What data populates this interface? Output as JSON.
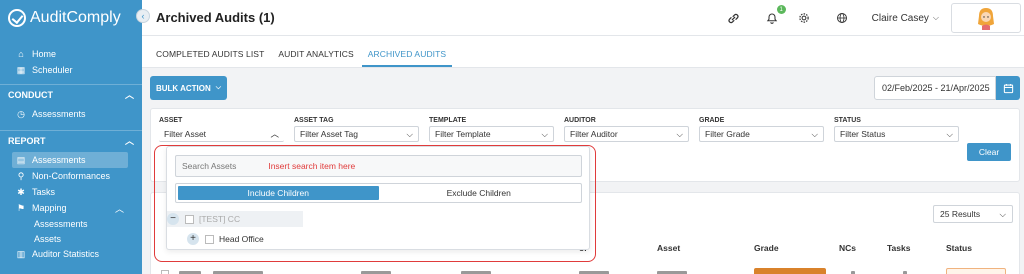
{
  "app": {
    "brand": "AuditComply",
    "page_title": "Archived Audits (1)"
  },
  "sidebar": {
    "top_items": [
      {
        "label": "Home",
        "icon": "home-icon"
      },
      {
        "label": "Scheduler",
        "icon": "calendar-icon"
      }
    ],
    "sections": [
      {
        "title": "CONDUCT",
        "items": [
          {
            "label": "Assessments",
            "icon": "clock-icon"
          }
        ]
      },
      {
        "title": "REPORT",
        "items": [
          {
            "label": "Assessments",
            "icon": "list-icon",
            "active": true
          },
          {
            "label": "Non-Conformances",
            "icon": "search-icon"
          },
          {
            "label": "Tasks",
            "icon": "tasks-icon"
          },
          {
            "label": "Mapping",
            "icon": "pin-icon"
          }
        ]
      }
    ],
    "mapping_sub": [
      "Assessments",
      "Assets"
    ],
    "cut_item": "Auditor Statistics"
  },
  "header": {
    "user_name": "Claire Casey",
    "notification_count": "1"
  },
  "tabs": [
    "COMPLETED AUDITS LIST",
    "AUDIT ANALYTICS",
    "ARCHIVED AUDITS"
  ],
  "toolbar": {
    "bulk_action": "BULK ACTION",
    "date_range": "02/Feb/2025 - 21/Apr/2025"
  },
  "filters": [
    {
      "label": "ASSET",
      "value": "Filter Asset"
    },
    {
      "label": "ASSET TAG",
      "value": "Filter Asset Tag"
    },
    {
      "label": "TEMPLATE",
      "value": "Filter Template"
    },
    {
      "label": "AUDITOR",
      "value": "Filter Auditor"
    },
    {
      "label": "GRADE",
      "value": "Filter Grade"
    },
    {
      "label": "STATUS",
      "value": "Filter Status"
    }
  ],
  "clear_label": "Clear",
  "dropdown": {
    "search_placeholder": "Search Assets",
    "annotation": "Insert search item here",
    "include_children": "Include Children",
    "exclude_children": "Exclude Children",
    "tree": [
      {
        "label": "[TEST] CC",
        "toggle": "−"
      },
      {
        "label": "Head Office",
        "toggle": "+"
      }
    ]
  },
  "table": {
    "results_per_page": "25 Results",
    "columns": [
      "or",
      "Asset",
      "Grade",
      "NCs",
      "Tasks",
      "Status"
    ]
  },
  "colors": {
    "accent": "#3f95c9",
    "annotation": "#e03b3b",
    "grade_chip": "#d9822b"
  }
}
